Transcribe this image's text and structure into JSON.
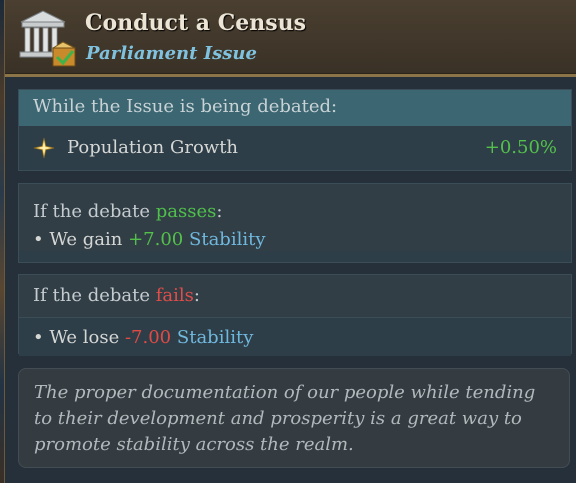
{
  "header": {
    "title": "Conduct a Census",
    "subtitle": "Parliament Issue",
    "icon": "parliament-temple-icon"
  },
  "debate_section": {
    "heading": "While the Issue is being debated:",
    "effect_label": "Population Growth",
    "effect_value": "+0.50%",
    "effect_icon": "star-icon"
  },
  "pass_section": {
    "heading_prefix": "If the debate ",
    "heading_keyword": "passes",
    "heading_suffix": ":",
    "bullet": "• We gain ",
    "amount": "+7.00",
    "stat": "Stability"
  },
  "fail_section": {
    "heading_prefix": "If the debate ",
    "heading_keyword": "fails",
    "heading_suffix": ":",
    "bullet": "• We lose ",
    "amount": "-7.00",
    "stat": "Stability"
  },
  "flavor_text": "The proper documentation of our people while tending to their development and prosperity is a great way to promote stability across the realm.",
  "colors": {
    "positive": "#53c04b",
    "negative": "#e04a45",
    "stat": "#6fb9de",
    "subtitle": "#7fc2e0"
  }
}
